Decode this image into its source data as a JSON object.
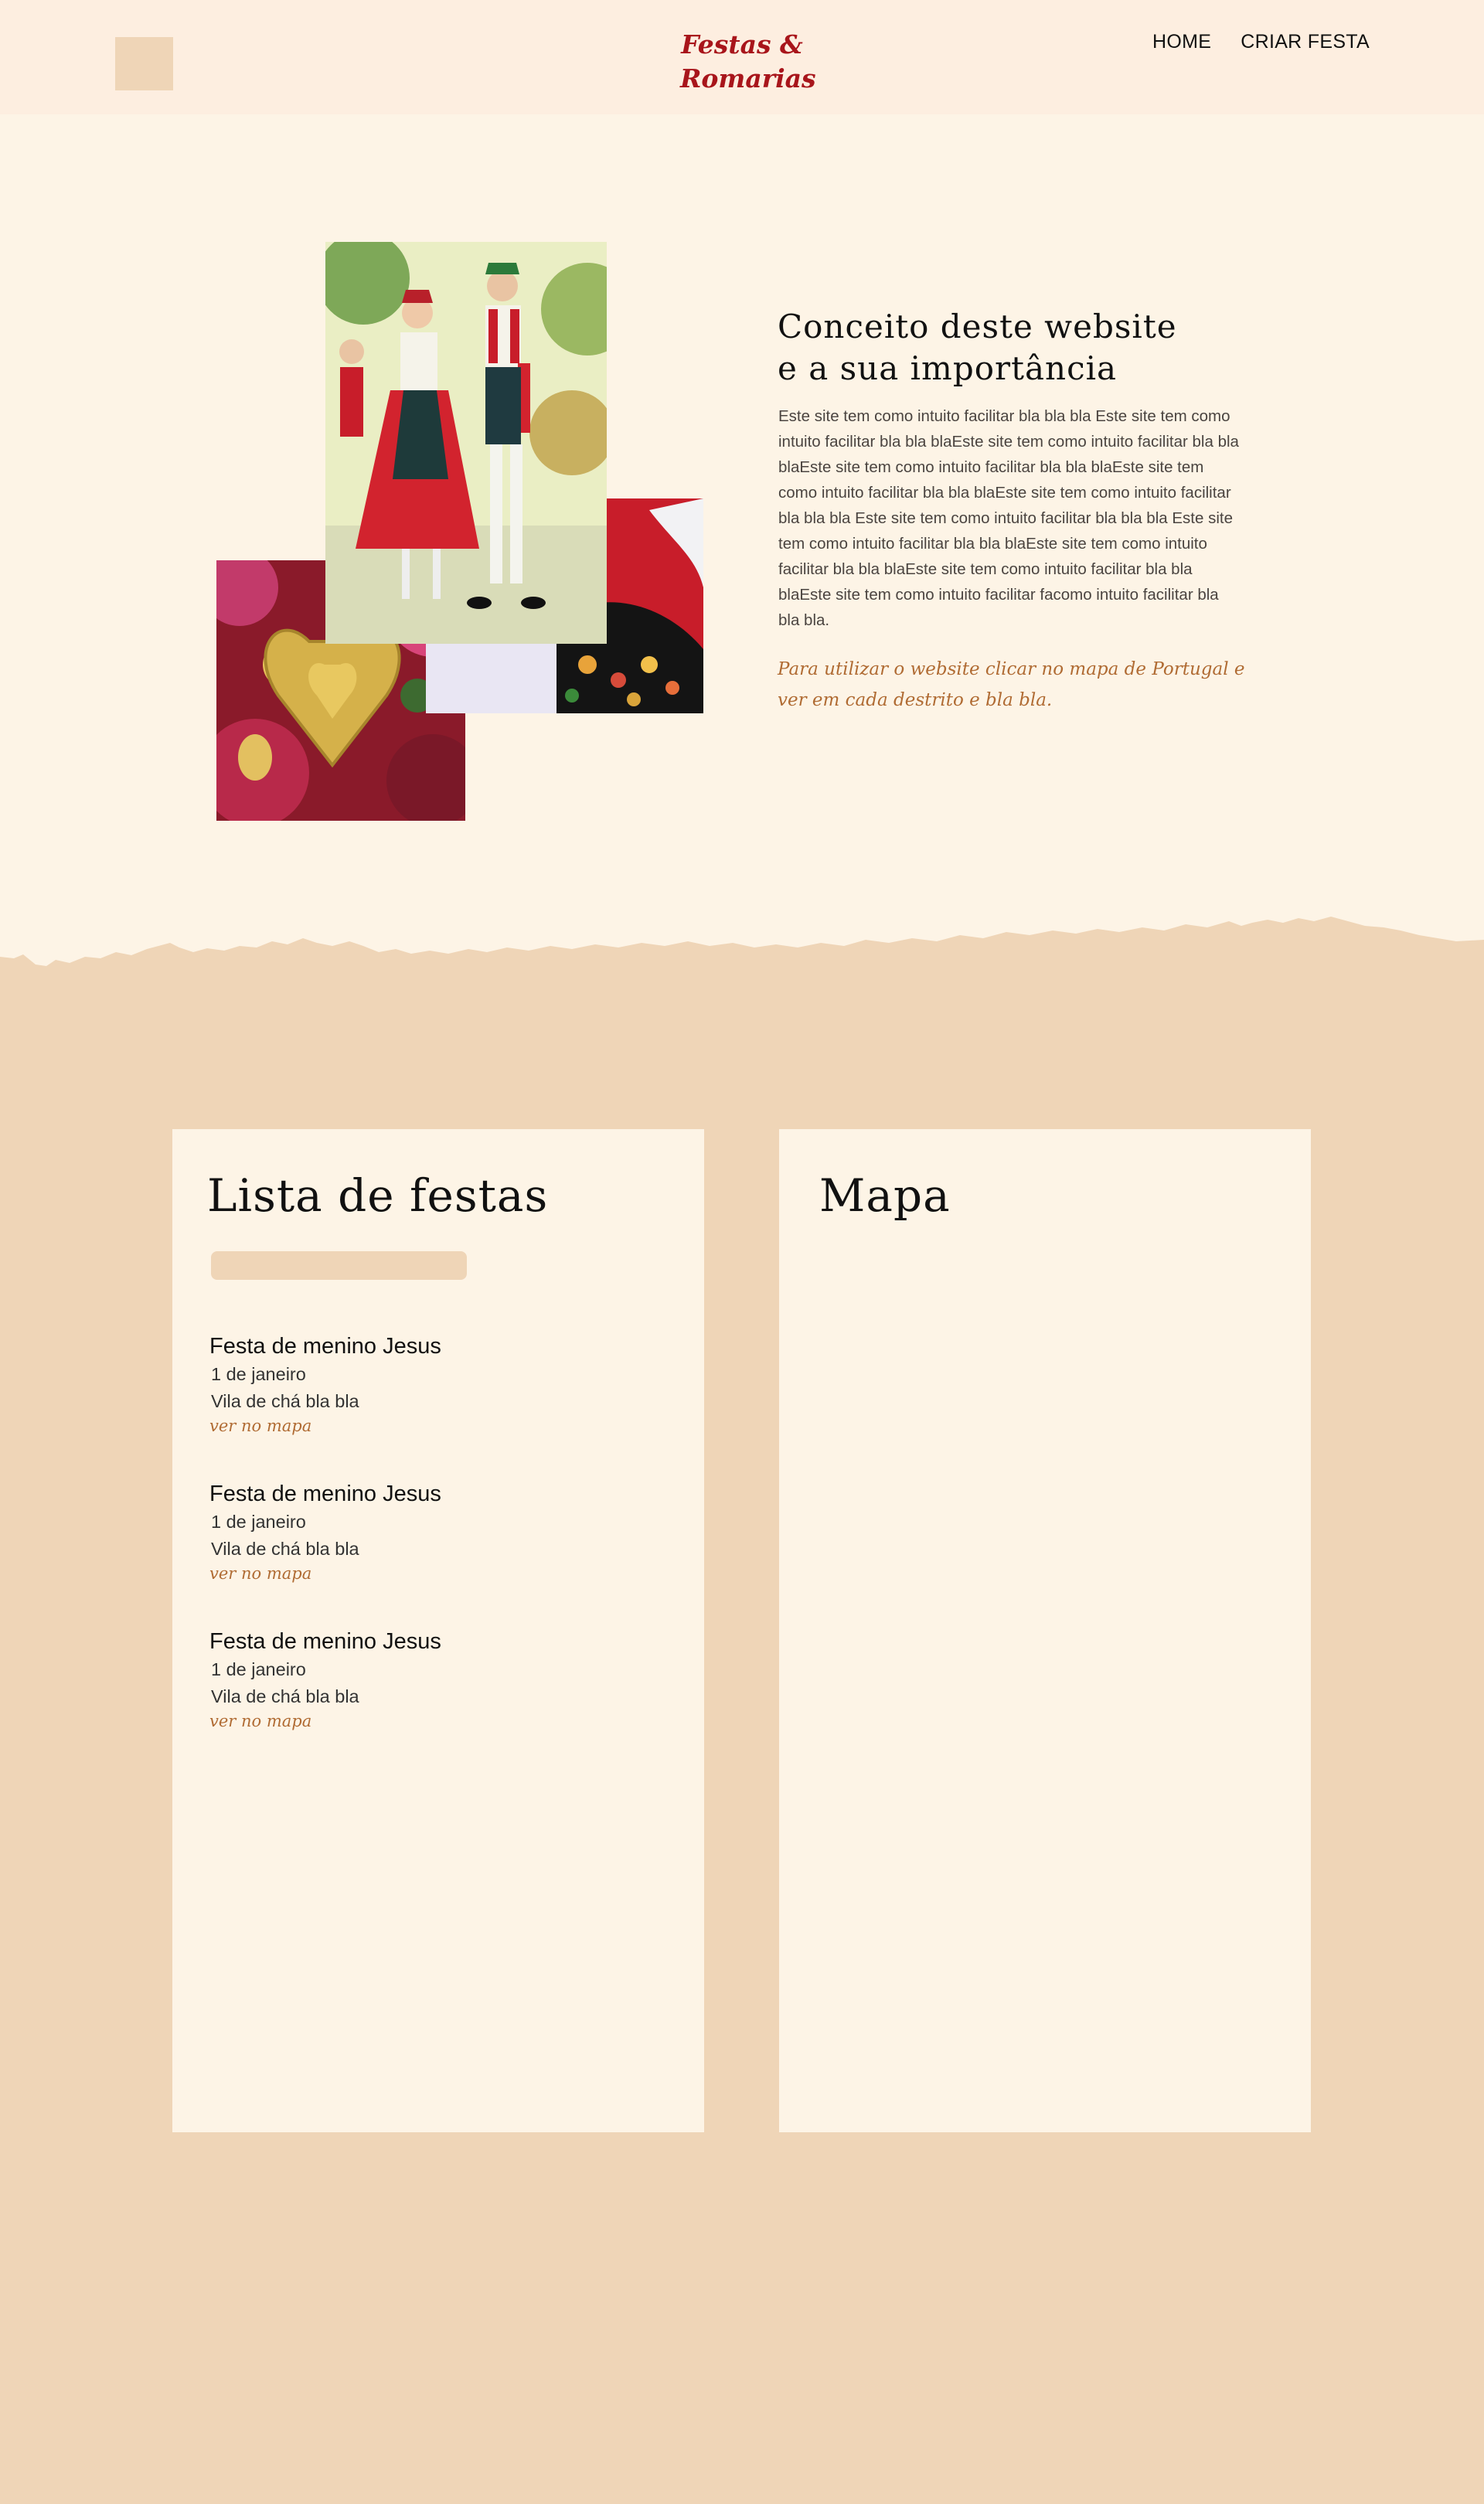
{
  "header": {
    "logo_line1": "Festas &",
    "logo_line2": "Romarias",
    "nav": [
      "HOME",
      "CRIAR FESTA"
    ]
  },
  "intro": {
    "title_line1": "Conceito deste website",
    "title_line2": "e a sua importância",
    "body": "Este site tem como intuito facilitar bla bla bla Este site tem como intuito facilitar bla bla blaEste site tem como intuito facilitar bla bla blaEste site tem como intuito facilitar bla bla blaEste site tem como intuito facilitar bla bla blaEste site tem como intuito facilitar bla bla bla Este site tem como intuito facilitar bla bla bla Este site tem como intuito facilitar bla bla blaEste site tem como intuito facilitar bla bla blaEste site tem como intuito facilitar bla bla blaEste site tem como intuito facilitar facomo intuito facilitar bla bla bla.",
    "cta": "Para utilizar o website clicar no mapa de Portugal e ver em cada destrito e bla bla."
  },
  "list": {
    "title": "Lista de festas",
    "search_value": "",
    "items": [
      {
        "name": "Festa de menino Jesus",
        "date": "1 de janeiro",
        "place": "Vila de chá bla bla",
        "link": "ver no mapa"
      },
      {
        "name": "Festa de menino Jesus",
        "date": "1 de janeiro",
        "place": "Vila de chá bla bla",
        "link": "ver no mapa"
      },
      {
        "name": "Festa de menino Jesus",
        "date": "1 de janeiro",
        "place": "Vila de chá bla bla",
        "link": "ver no mapa"
      }
    ]
  },
  "map": {
    "title": "Mapa"
  },
  "colors": {
    "header_bg": "#fdeee0",
    "section_bg": "#fdf4e6",
    "accent_sand": "#efd5b7",
    "logo_red": "#a8151b",
    "link_brown": "#b06b33"
  }
}
